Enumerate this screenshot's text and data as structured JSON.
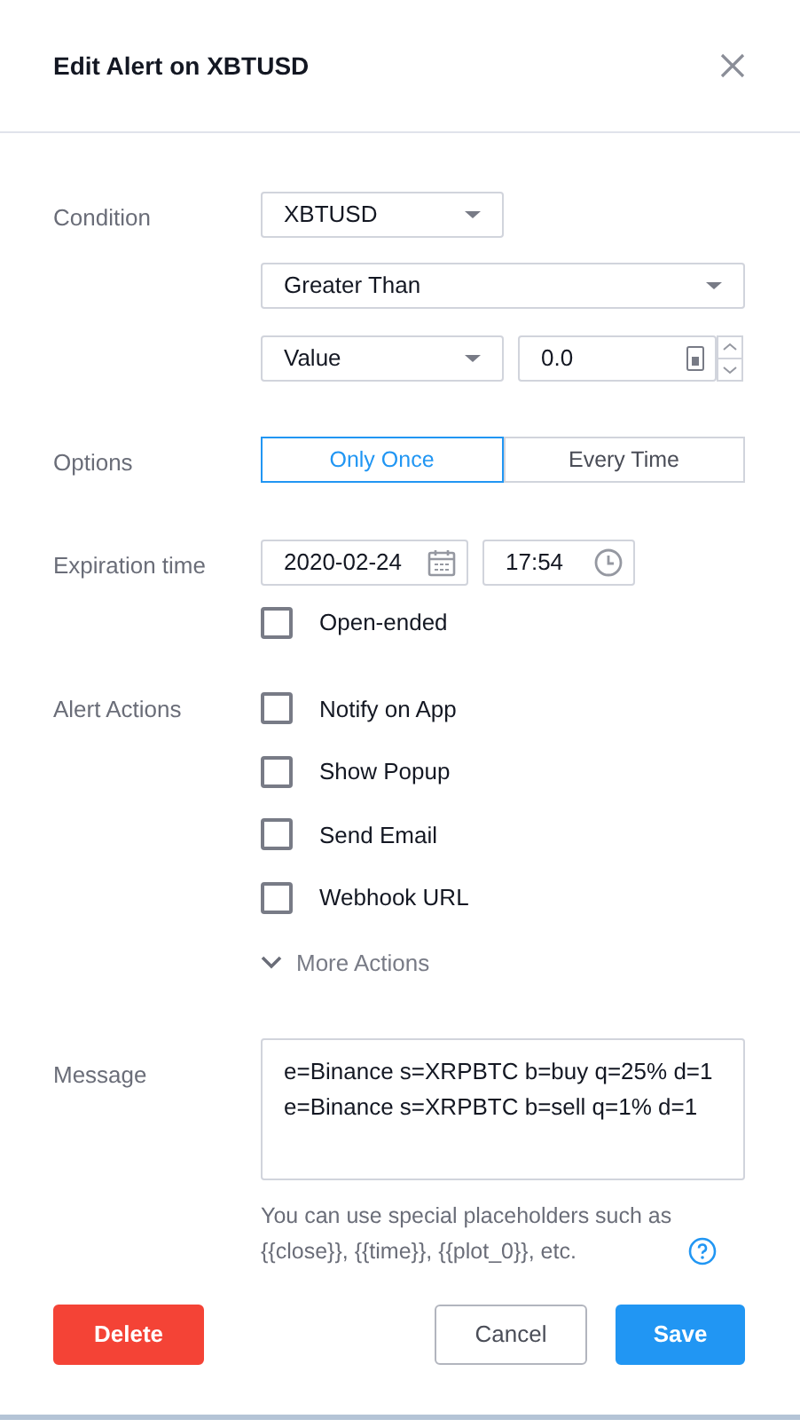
{
  "dialog": {
    "title": "Edit Alert on XBTUSD"
  },
  "condition": {
    "label": "Condition",
    "symbol": "XBTUSD",
    "operator": "Greater Than",
    "source": "Value",
    "value": "0.0"
  },
  "options": {
    "label": "Options",
    "choices": [
      {
        "label": "Only Once",
        "selected": true
      },
      {
        "label": "Every Time",
        "selected": false
      }
    ]
  },
  "expiration": {
    "label": "Expiration time",
    "date": "2020-02-24",
    "time": "17:54",
    "open_ended": {
      "label": "Open-ended",
      "checked": false
    }
  },
  "alert_actions": {
    "label": "Alert Actions",
    "items": [
      {
        "label": "Notify on App",
        "checked": false
      },
      {
        "label": "Show Popup",
        "checked": false
      },
      {
        "label": "Send Email",
        "checked": false
      },
      {
        "label": "Webhook URL",
        "checked": false
      }
    ],
    "more": "More Actions"
  },
  "message": {
    "label": "Message",
    "value": "e=Binance s=XRPBTC b=buy q=25% d=1\ne=Binance s=XRPBTC b=sell q=1% d=1",
    "hint": "You can use special placeholders such as {{close}}, {{time}}, {{plot_0}}, etc."
  },
  "buttons": [
    {
      "label": "Delete",
      "kind": "danger"
    },
    {
      "label": "Cancel",
      "kind": "secondary"
    },
    {
      "label": "Save",
      "kind": "primary"
    }
  ]
}
